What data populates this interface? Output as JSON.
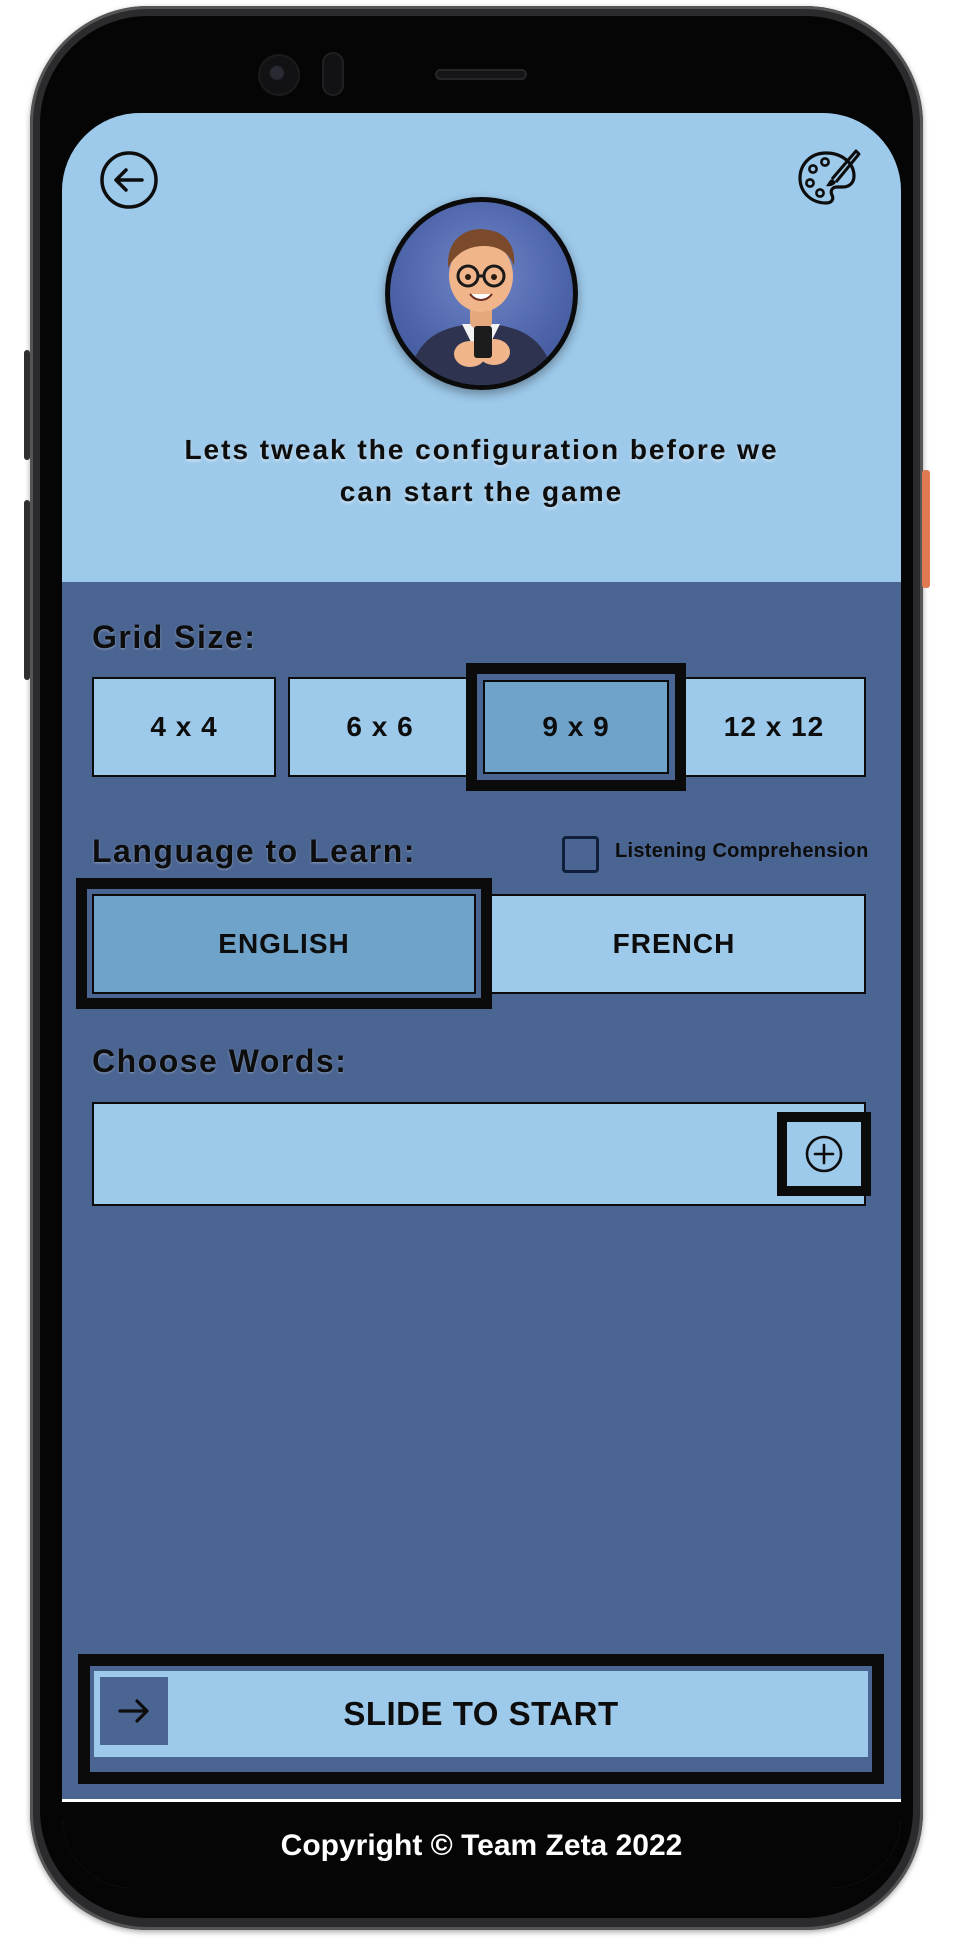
{
  "intro": {
    "line1": "Lets tweak the configuration before we",
    "line2": "can start the game"
  },
  "grid_size": {
    "label": "Grid Size:",
    "options": [
      "4 x 4",
      "6 x 6",
      "9 x 9",
      "12 x 12"
    ],
    "selected": "9 x 9"
  },
  "language": {
    "label": "Language to Learn:",
    "options": [
      "ENGLISH",
      "FRENCH"
    ],
    "selected": "ENGLISH",
    "listening_label": "Listening Comprehension",
    "listening_checked": false
  },
  "words": {
    "label": "Choose Words:",
    "value": ""
  },
  "start": {
    "label": "SLIDE TO START"
  },
  "footer": {
    "copyright": "Copyright © Team Zeta 2022"
  },
  "icons": {
    "back": "arrow-left-circle-icon",
    "theme": "palette-icon",
    "add": "plus-circle-icon",
    "slide": "arrow-right-icon"
  },
  "colors": {
    "light_blue": "#9dc9ea",
    "selected_blue": "#6fa3c9",
    "dark_blue": "#4b6592",
    "black": "#0b0b0b"
  }
}
